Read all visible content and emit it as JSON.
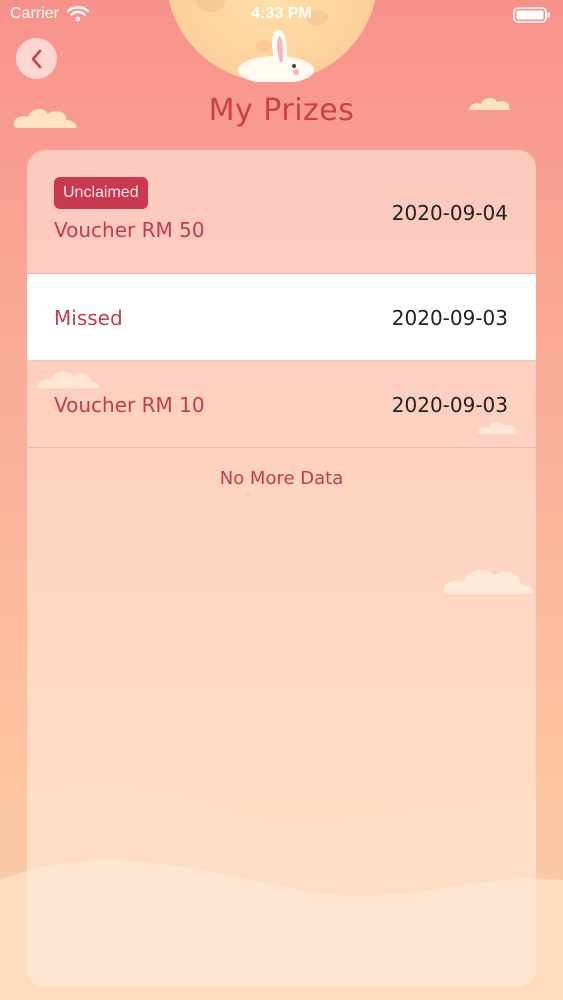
{
  "status_bar": {
    "carrier": "Carrier",
    "time": "4:33 PM"
  },
  "header": {
    "back_icon": "chevron-left-icon",
    "title": "My Prizes"
  },
  "prizes": [
    {
      "badge": "Unclaimed",
      "name": "Voucher RM 50",
      "date": "2020-09-04"
    },
    {
      "badge": "",
      "name": "Missed",
      "date": "2020-09-03"
    },
    {
      "badge": "",
      "name": "Voucher RM 10",
      "date": "2020-09-03"
    }
  ],
  "footer": {
    "no_more_text": "No More Data"
  },
  "colors": {
    "accent": "#c8424a",
    "badge_bg": "#c8384e",
    "background_top": "#f7928b",
    "background_bottom": "#fdd0a8"
  }
}
